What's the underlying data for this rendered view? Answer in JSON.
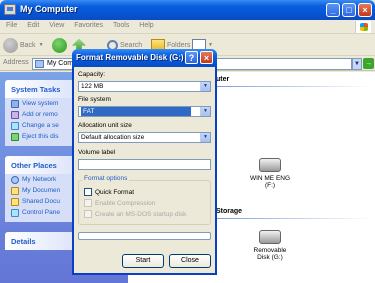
{
  "window": {
    "title": "My Computer",
    "menu": [
      "File",
      "Edit",
      "View",
      "Favorites",
      "Tools",
      "Help"
    ],
    "toolbar": {
      "back": "Back",
      "search": "Search",
      "folders": "Folders"
    },
    "address": {
      "label": "Address",
      "value": "My Com",
      "go": "Go"
    }
  },
  "left_pane": {
    "system_tasks": {
      "title": "System Tasks",
      "items": [
        "View system",
        "Add or remo",
        "Change a se",
        "Eject this dis"
      ]
    },
    "other_places": {
      "title": "Other Places",
      "items": [
        "My Network",
        "My Documen",
        "Shared Docu",
        "Control Pane"
      ]
    },
    "details": {
      "title": "Details"
    }
  },
  "content": {
    "section1_title": "uter",
    "drive1": {
      "label": "WIN ME ENG",
      "sub": "(F:)"
    },
    "section2_title": "Storage",
    "drive2": {
      "label": "Removable",
      "sub": "Disk (G:)"
    }
  },
  "dialog": {
    "title": "Format Removable Disk (G:)",
    "capacity": {
      "label": "Capacity:",
      "value": "122 MB"
    },
    "file_system": {
      "label": "File system",
      "value": "FAT"
    },
    "allocation": {
      "label": "Allocation unit size",
      "value": "Default allocation size"
    },
    "volume": {
      "label": "Volume label",
      "value": ""
    },
    "format_options": {
      "title": "Format options",
      "quick": "Quick Format",
      "compression": "Enable Compression",
      "startup": "Create an MS-DOS startup disk"
    },
    "start_label": "Start",
    "close_label": "Close"
  },
  "colors": {
    "xp_blue": "#0654D4",
    "task_pane": "#7BA2E7",
    "selection": "#316AC5"
  }
}
